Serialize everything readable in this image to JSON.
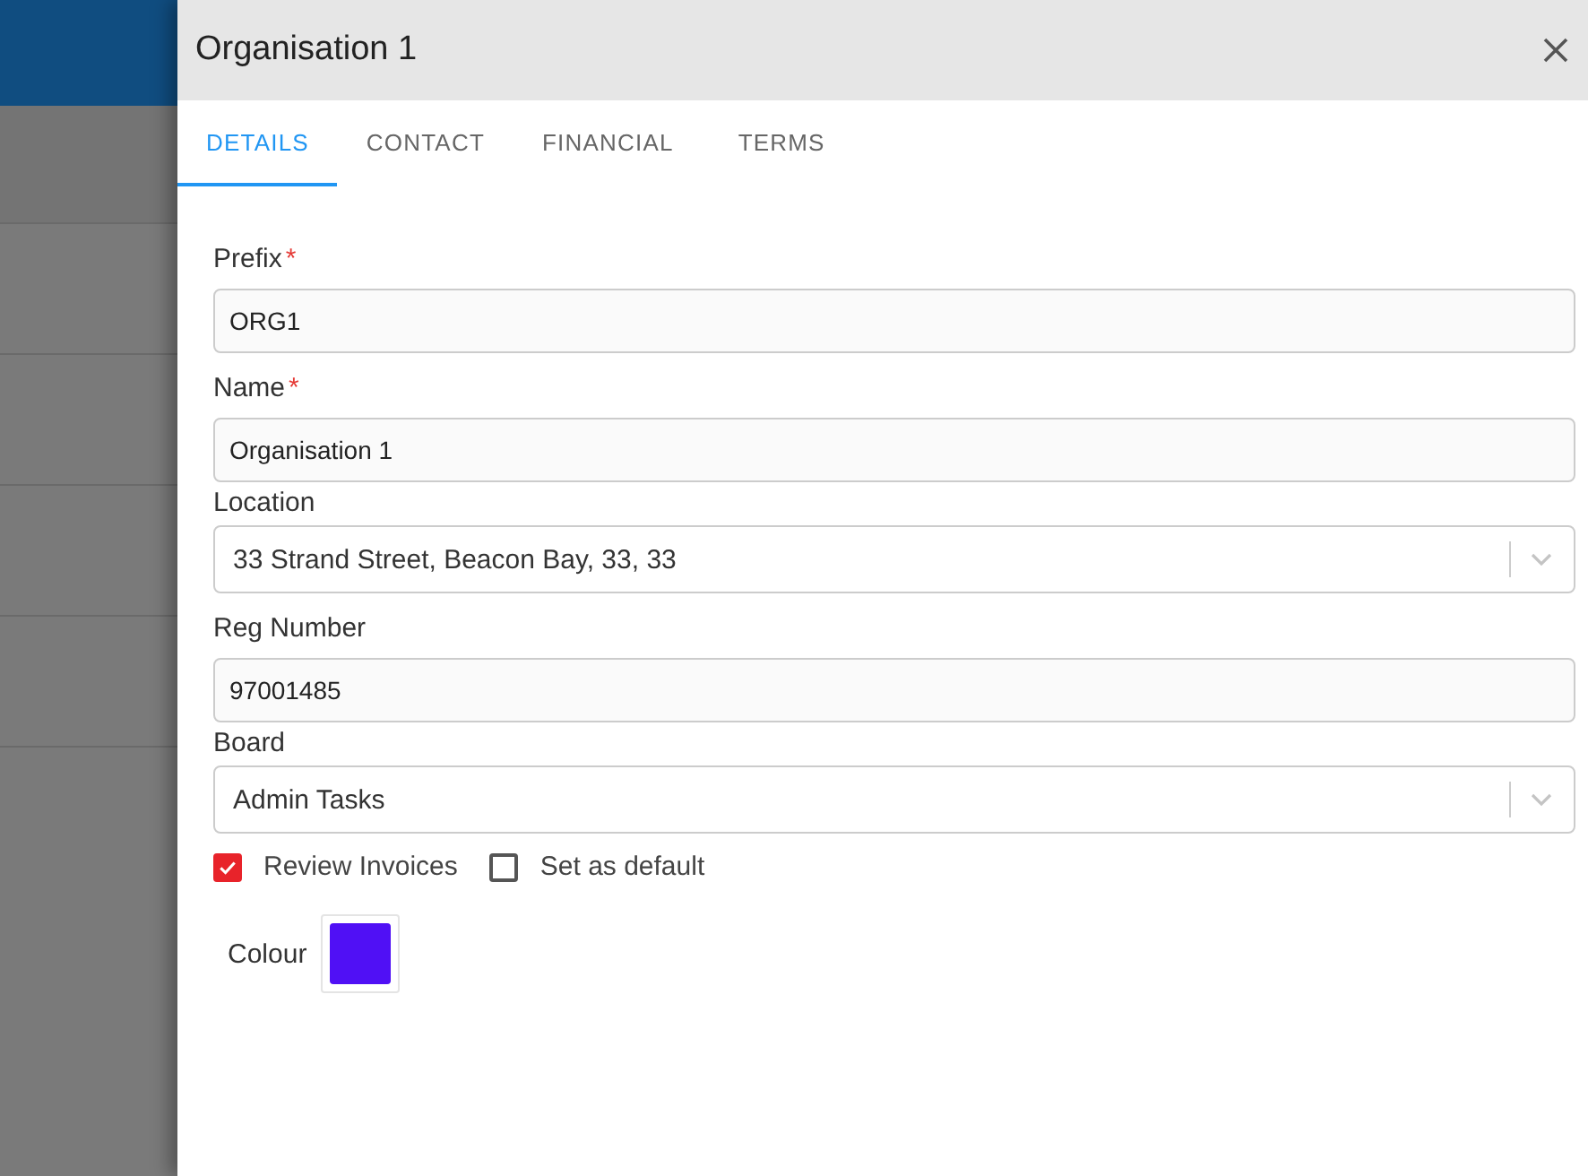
{
  "drawer": {
    "title": "Organisation 1"
  },
  "tabs": [
    {
      "label": "DETAILS",
      "selected": true
    },
    {
      "label": "CONTACT",
      "selected": false
    },
    {
      "label": "FINANCIAL",
      "selected": false
    },
    {
      "label": "TERMS",
      "selected": false
    }
  ],
  "fields": [
    {
      "kind": "text",
      "label": "Prefix",
      "required_mark": "*",
      "value": "ORG1"
    },
    {
      "kind": "text",
      "label": "Name",
      "required_mark": "*",
      "value": "Organisation 1"
    },
    {
      "kind": "select",
      "label": "Location",
      "value": "33 Strand Street, Beacon Bay, 33, 33"
    },
    {
      "kind": "text",
      "label": "Reg Number",
      "value": "97001485"
    },
    {
      "kind": "select",
      "label": "Board",
      "value": "Admin Tasks"
    }
  ],
  "checkboxes": [
    {
      "label": "Review Invoices",
      "checked": true
    },
    {
      "label": "Set as default",
      "checked": false
    }
  ],
  "colour": {
    "label": "Colour",
    "color": "#5010f5"
  }
}
